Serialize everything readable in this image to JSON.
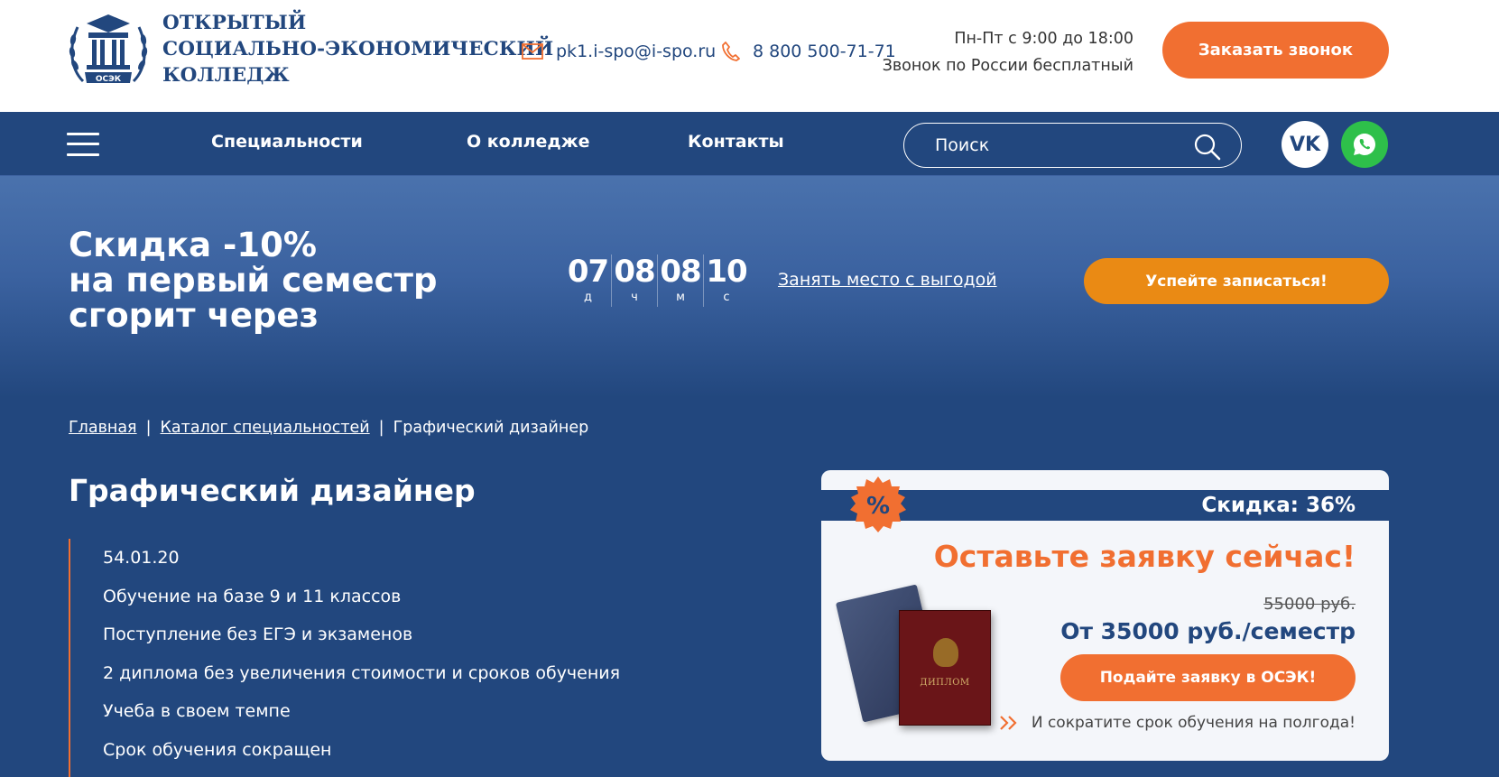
{
  "header": {
    "brand_lines": [
      "ОТКРЫТЫЙ",
      "СОЦИАЛЬНО-ЭКОНОМИЧЕСКИЙ",
      "КОЛЛЕДЖ"
    ],
    "logo_text": "ОСЭК",
    "email": "pk1.i-spo@i-spo.ru",
    "phone": "8 800 500-71-71",
    "hours": "Пн-Пт с 9:00 до 18:00",
    "hours_note": "Звонок по России бесплатный",
    "call_button": "Заказать звонок"
  },
  "nav": {
    "links": [
      "Специальности",
      "О колледже",
      "Контакты"
    ],
    "search_placeholder": "Поиск",
    "vk_label": "VK"
  },
  "promo": {
    "title_lines": [
      "Скидка -10%",
      "на первый семестр",
      "сгорит через"
    ],
    "timer": [
      {
        "value": "07",
        "unit": "д"
      },
      {
        "value": "08",
        "unit": "ч"
      },
      {
        "value": "08",
        "unit": "м"
      },
      {
        "value": "10",
        "unit": "с"
      }
    ],
    "link": "Занять место с выгодой",
    "button": "Успейте записаться!"
  },
  "breadcrumb": [
    "Главная",
    "Каталог специальностей",
    "Графический дизайнер"
  ],
  "page_title": "Графический дизайнер",
  "features": [
    "54.01.20",
    "Обучение на базе 9 и 11 классов",
    "Поступление без ЕГЭ и экзаменов",
    "2 диплома без увеличения стоимости и сроков обучения",
    "Учеба в своем темпе",
    "Срок обучения сокращен"
  ],
  "card": {
    "badge": "%",
    "discount": "Скидка: 36%",
    "headline": "Оставьте заявку сейчас!",
    "old_price": "55000 руб.",
    "price": "От 35000 руб./семестр",
    "button": "Подайте заявку в ОСЭК!",
    "note": "И сократите срок обучения на полгода!",
    "diploma_text": "ДИПЛОМ"
  },
  "colors": {
    "navy": "#22477e",
    "orange": "#f16f31",
    "amber": "#ea8a14",
    "whatsapp": "#2ec04a"
  }
}
